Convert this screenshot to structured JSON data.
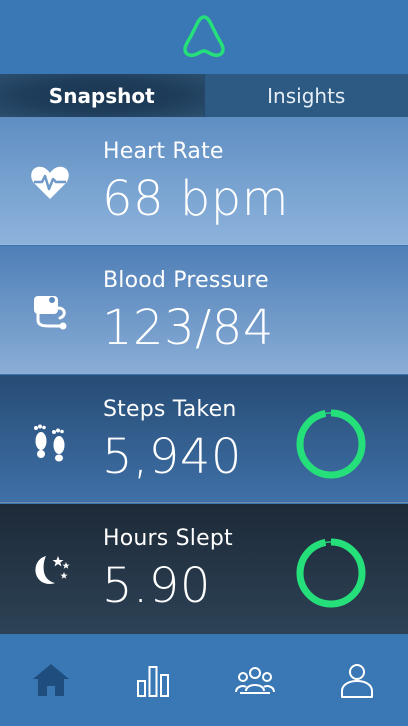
{
  "tabs": [
    {
      "label": "Snapshot",
      "active": true
    },
    {
      "label": "Insights",
      "active": false
    }
  ],
  "cards": [
    {
      "label": "Heart Rate",
      "value": "68 bpm",
      "icon": "heart-pulse-icon"
    },
    {
      "label": "Blood Pressure",
      "value": "123/84",
      "icon": "blood-pressure-cuff-icon"
    },
    {
      "label": "Steps Taken",
      "value": "5,940",
      "icon": "footprints-icon",
      "progress_fraction": 0.97
    },
    {
      "label": "Hours Slept",
      "value": "5.90",
      "icon": "moon-stars-icon",
      "progress_fraction": 0.97
    }
  ],
  "nav": [
    {
      "icon": "home-icon",
      "active": true
    },
    {
      "icon": "bar-chart-icon",
      "active": false
    },
    {
      "icon": "group-icon",
      "active": false
    },
    {
      "icon": "profile-icon",
      "active": false
    }
  ],
  "colors": {
    "accent_green": "#25e07a",
    "header_blue": "#3a78b5",
    "active_nav": "#1f4e7e"
  }
}
